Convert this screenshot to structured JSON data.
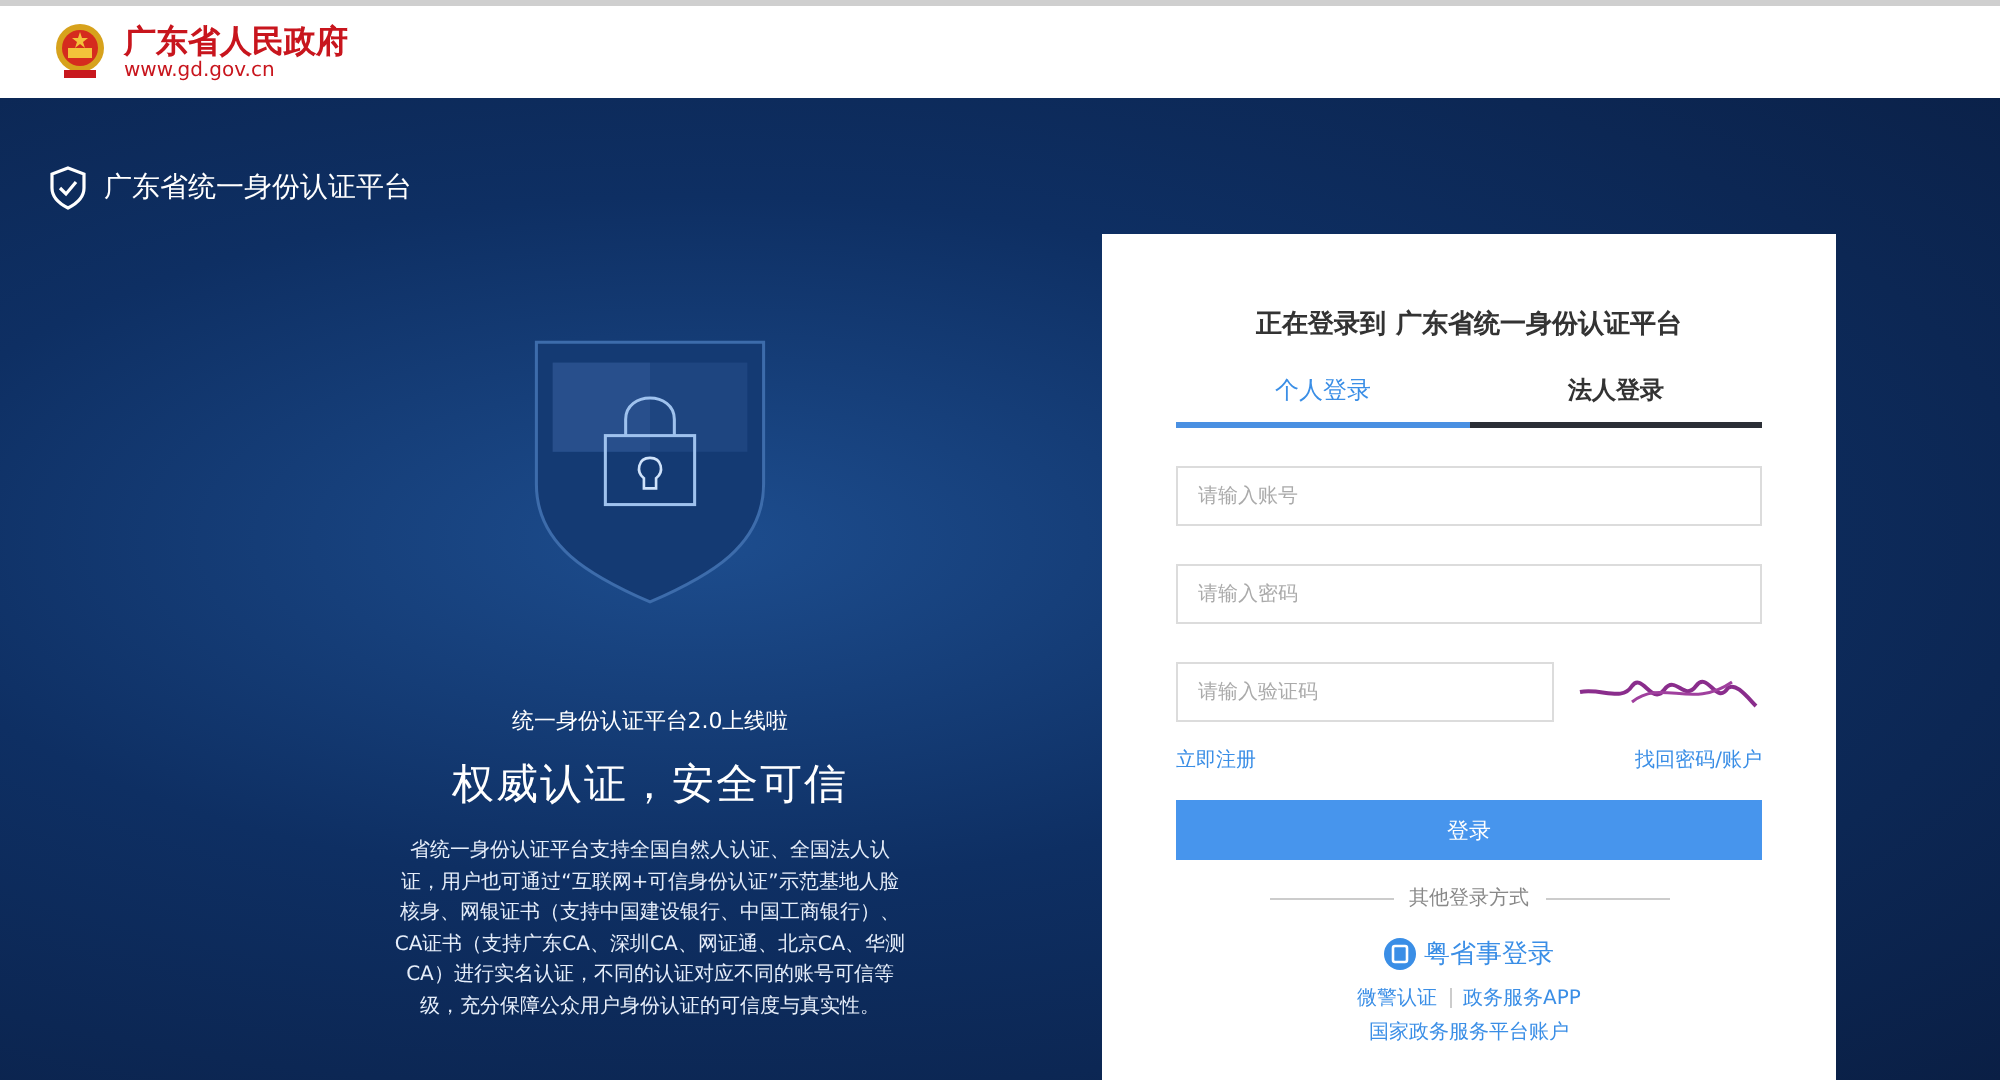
{
  "header": {
    "site_name": "广东省人民政府",
    "site_url": "www.gd.gov.cn"
  },
  "platform": {
    "title": "广东省统一身份认证平台"
  },
  "promo": {
    "subtitle": "统一身份认证平台2.0上线啦",
    "headline": "权威认证，安全可信",
    "description": "省统一身份认证平台支持全国自然人认证、全国法人认证，用户也可通过“互联网+可信身份认证”示范基地人脸核身、网银证书（支持中国建设银行、中国工商银行）、CA证书（支持广东CA、深圳CA、网证通、北京CA、华测CA）进行实名认证，不同的认证对应不同的账号可信等级，充分保障公众用户身份认证的可信度与真实性。"
  },
  "login": {
    "title": "正在登录到 广东省统一身份认证平台",
    "tabs": [
      {
        "label": "个人登录",
        "selected": true
      },
      {
        "label": "法人登录",
        "selected": false
      }
    ],
    "fields": [
      {
        "placeholder": "请输入账号",
        "kind": "text"
      },
      {
        "placeholder": "请输入密码",
        "kind": "password"
      },
      {
        "placeholder": "请输入验证码",
        "kind": "captcha"
      }
    ],
    "register_link": "立即注册",
    "recover_link": "找回密码/账户",
    "submit": "登录",
    "other_title": "其他登录方式",
    "app_login": "粤省事登录",
    "other_links": [
      "微警认证",
      "政务服务APP"
    ],
    "national_link": "国家政务服务平台账户"
  }
}
